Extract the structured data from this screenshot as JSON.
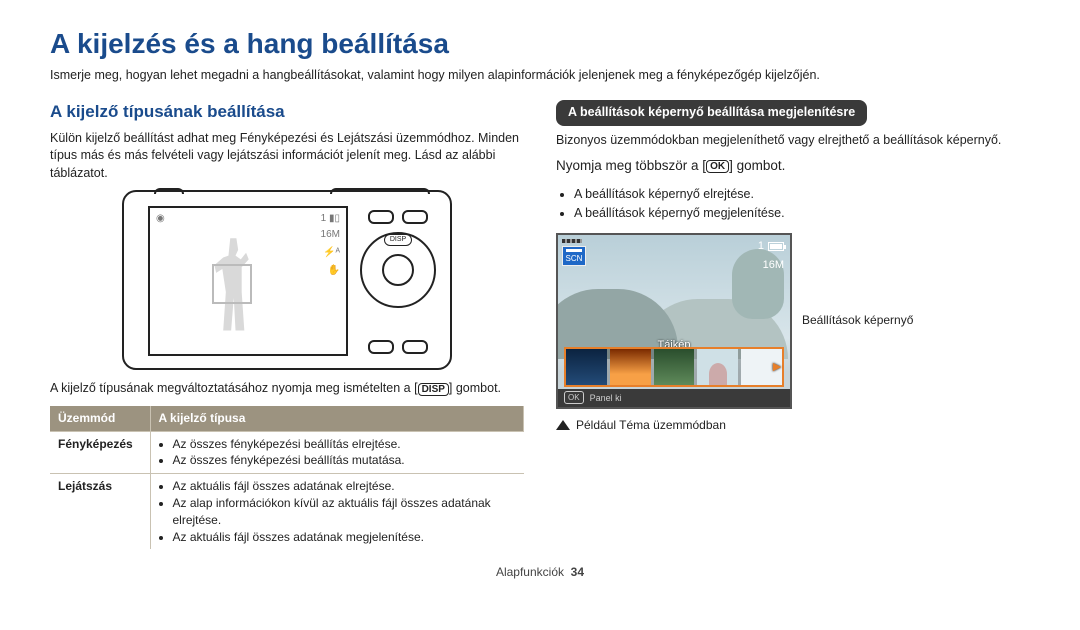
{
  "title": "A kijelzés és a hang beállítása",
  "intro": "Ismerje meg, hogyan lehet megadni a hangbeállításokat, valamint hogy milyen alapinformációk jelenjenek meg a fényképezőgép kijelzőjén.",
  "left": {
    "subheader": "A kijelző típusának beállítása",
    "para1": "Külön kijelző beállítást adhat meg Fényképezési és Lejátszási üzemmódhoz. Minden típus más és más felvételi vagy lejátszási információt jelenít meg. Lásd az alábbi táblázatot.",
    "caption_pre": "A kijelző típusának megváltoztatásához nyomja meg ismételten a [",
    "disp": "DISP",
    "caption_post": "] gombot.",
    "table": {
      "h1": "Üzemmód",
      "h2": "A kijelző típusa",
      "rows": [
        {
          "mode": "Fényképezés",
          "items": [
            "Az összes fényképezési beállítás elrejtése.",
            "Az összes fényképezési beállítás mutatása."
          ]
        },
        {
          "mode": "Lejátszás",
          "items": [
            "Az aktuális fájl összes adatának elrejtése.",
            "Az alap információkon kívül az aktuális fájl összes adatának elrejtése.",
            "Az aktuális fájl összes adatának megjelenítése."
          ]
        }
      ]
    },
    "camera": {
      "counter": "1",
      "res": "16M",
      "icons": [
        "camera-icon",
        "battery-icon",
        "res-icon",
        "flash-icon",
        "steady-icon"
      ],
      "disp": "DISP"
    }
  },
  "right": {
    "pill": "A beállítások képernyő beállítása megjelenítésre",
    "para1": "Bizonyos üzemmódokban megjeleníthető vagy elrejthető a beállítások képernyő.",
    "instr_pre": "Nyomja meg többször a [",
    "ok": "OK",
    "instr_post": "] gombot.",
    "bullets": [
      "A beállítások képernyő elrejtése.",
      "A beállítások képernyő megjelenítése."
    ],
    "preview": {
      "scn": "SCN",
      "counter": "1",
      "res": "16M",
      "label": "Tájkép",
      "panel_ok": "OK",
      "panel_text": "Panel ki"
    },
    "side_caption": "Beállítások képernyő",
    "example": "Például Téma üzemmódban"
  },
  "footer": {
    "section": "Alapfunkciók",
    "page": "34"
  }
}
